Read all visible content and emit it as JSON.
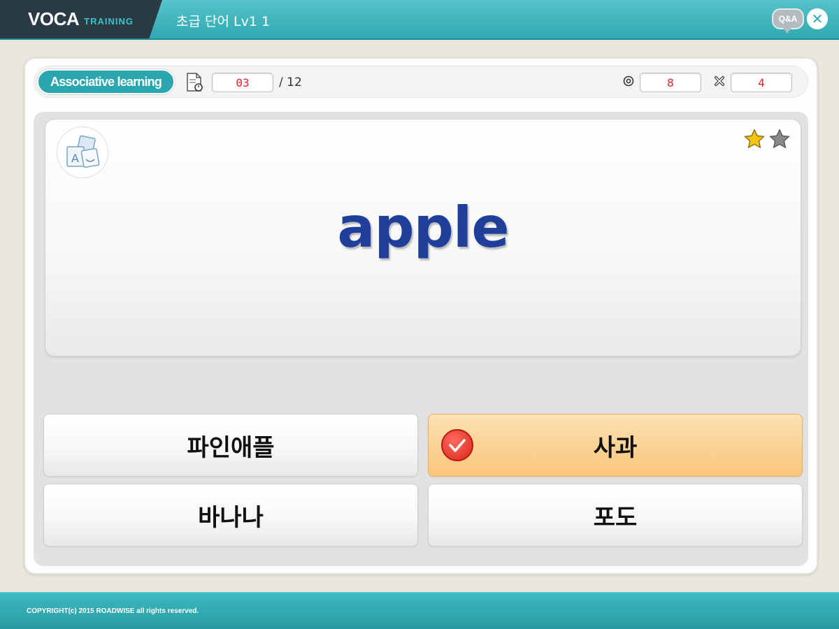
{
  "header": {
    "logo_main": "VOCA",
    "logo_sub": "TRAINING",
    "title": "초급 단어 Lv1 1",
    "qa_label": "Q&A",
    "close_glyph": "✕"
  },
  "status": {
    "mode": "Associative learning",
    "current": "03",
    "total": "/ 12",
    "correct_count": "8",
    "wrong_count": "4"
  },
  "card": {
    "word": "apple",
    "stars_filled": 1,
    "stars_total": 2
  },
  "choices": [
    {
      "label": "파인애플",
      "selected": false
    },
    {
      "label": "사과",
      "selected": true
    },
    {
      "label": "바나나",
      "selected": false
    },
    {
      "label": "포도",
      "selected": false
    }
  ],
  "footer": {
    "copyright": "COPYRIGHT(c) 2015 ROADWISE all rights reserved."
  },
  "colors": {
    "accent": "#2fa9b1",
    "word": "#1f3f9a",
    "counter": "#e1262c",
    "selected": "#f9c57a"
  }
}
